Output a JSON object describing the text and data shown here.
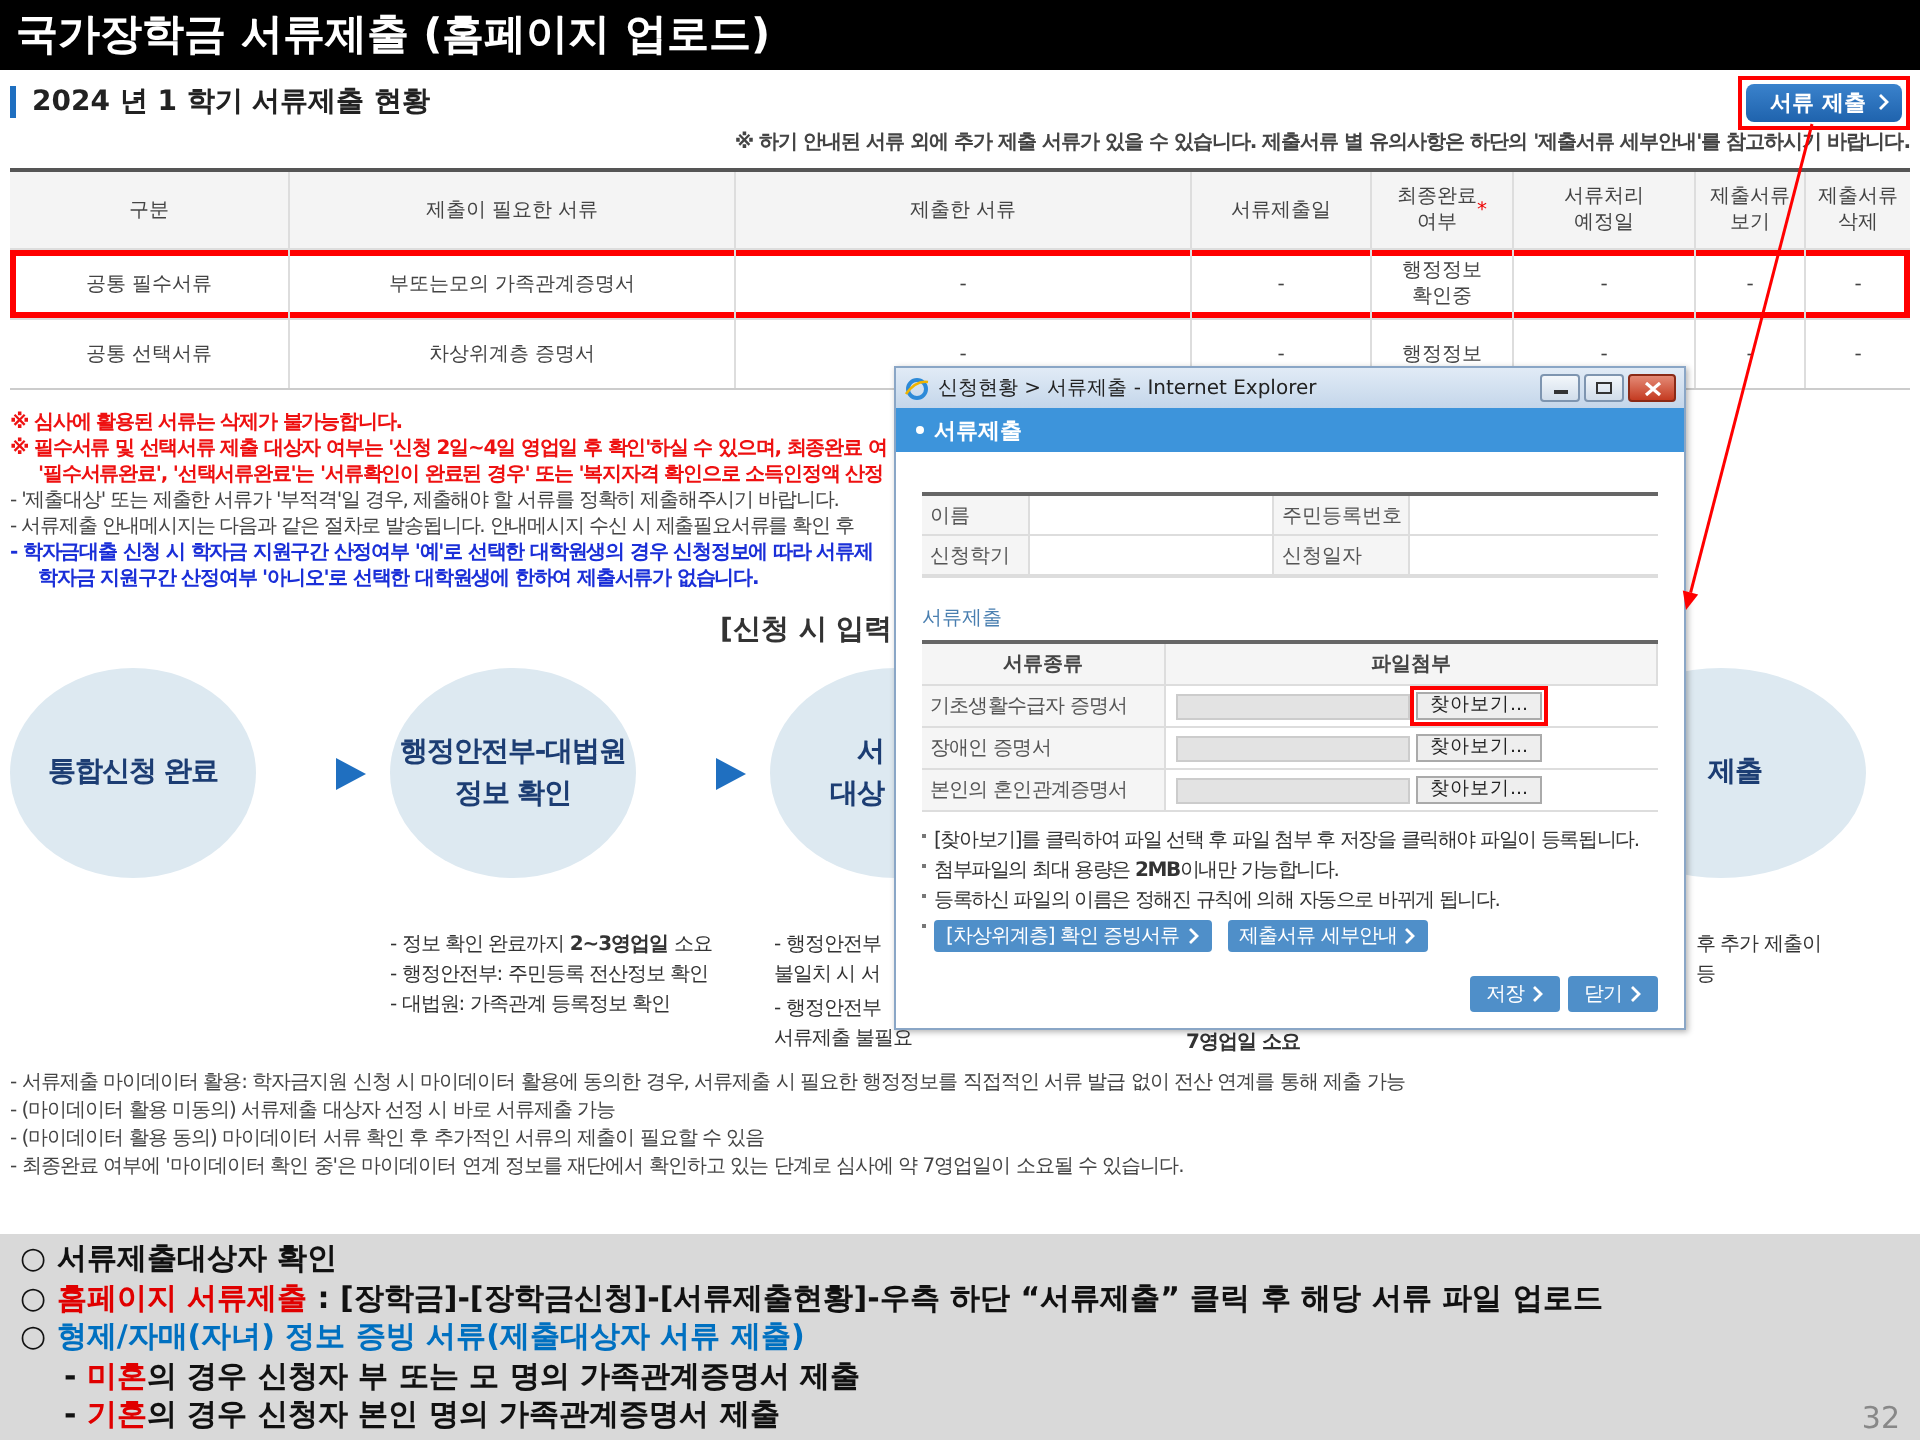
{
  "slide_title": "국가장학금 서류제출 (홈페이지 업로드)",
  "status": {
    "heading": "2024 년 1 학기 서류제출 현황",
    "submit_button": {
      "label": "서류 제출",
      "highlighted": true
    },
    "note": "※ 하기 안내된 서류 외에 추가 제출 서류가 있을 수 있습니다. 제출서류 별 유의사항은 하단의 '제출서류 세부안내'를 참고하시기 바랍니다."
  },
  "table": {
    "columns": [
      {
        "label": "구분"
      },
      {
        "label": "제출이 필요한 서류"
      },
      {
        "label": "제출한 서류"
      },
      {
        "label": "서류제출일"
      },
      {
        "label": "최종완료\n여부",
        "required_mark": "*"
      },
      {
        "label": "서류처리\n예정일"
      },
      {
        "label": "제출서류\n보기"
      },
      {
        "label": "제출서류\n삭제"
      }
    ],
    "rows": [
      {
        "cells": [
          "공통 필수서류",
          "부또는모의 가족관계증명서",
          "-",
          "-",
          "행정정보\n확인중",
          "-",
          "-",
          "-"
        ],
        "highlighted": true
      },
      {
        "cells": [
          "공통 선택서류",
          "차상위계층 증명서",
          "-",
          "-",
          "행정정보",
          "-",
          "-",
          "-"
        ],
        "highlighted": false
      }
    ]
  },
  "notes": [
    {
      "kind": "warning",
      "text": "※ 심사에 활용된 서류는 삭제가 불가능합니다."
    },
    {
      "kind": "warning",
      "text": "※ 필수서류 및 선택서류 제출 대상자 여부는 '신청 2일~4일 영업일 후 확인'하실 수 있으며, 최종완료 여"
    },
    {
      "kind": "warning-continued",
      "text": "'필수서류완료', '선택서류완료'는 '서류확인이 완료된 경우' 또는 '복지자격 확인으로 소득인정액 산정"
    },
    {
      "kind": "plain",
      "text": "- '제출대상' 또는 제출한 서류가 '부적격'일 경우, 제출해야 할 서류를 정확히 제출해주시기 바랍니다."
    },
    {
      "kind": "plain",
      "text": "- 서류제출 안내메시지는 다음과 같은 절차로 발송됩니다. 안내메시지 수신 시 제출필요서류를 확인 후"
    },
    {
      "kind": "info",
      "text": "- 학자금대출 신청 시 학자금 지원구간 산정여부 '예'로 선택한 대학원생의 경우 신청정보에 따라 서류제"
    },
    {
      "kind": "info-continued",
      "text": "학자금 지원구간 산정여부 '아니오'로 선택한 대학원생에 한하여 제출서류가 없습니다."
    }
  ],
  "flow": {
    "caption": "[신청 시 입력",
    "steps": [
      {
        "lines": [
          "통합신청 완료"
        ]
      },
      {
        "lines": [
          "행정안전부-대법원",
          "정보 확인"
        ]
      },
      {
        "lines": [
          "서",
          "대상"
        ]
      },
      {
        "lines": [
          "제출"
        ]
      }
    ]
  },
  "details": [
    {
      "kind": "bullets",
      "items": [
        "- 정보 확인 완료까지 **2~3영업일** 소요",
        "- 행정안전부: 주민등록 전산정보 확인",
        "- 대법원: 가족관계 등록정보 확인"
      ]
    },
    {
      "kind": "bullets",
      "items": [
        "- 행정안전부\n불일치 시 서",
        "- 행정안전부\n서류제출 불필요"
      ]
    },
    {
      "kind": "strong",
      "items": [
        "7영업일 소요"
      ]
    },
    {
      "kind": "plain",
      "items": [
        "후 추가 제출이\n등"
      ]
    }
  ],
  "footnotes": [
    "- 서류제출 마이데이터 활용: 학자금지원 신청 시 마이데이터 활용에 동의한 경우, 서류제출 시 필요한 행정정보를 직접적인 서류 발급 없이 전산 연계를 통해 제출 가능",
    "- (마이데이터 활용 미동의) 서류제출 대상자 선정 시 바로 서류제출 가능",
    "- (마이데이터 활용 동의) 마이데이터 서류 확인 후 추가적인 서류의 제출이 필요할 수 있음",
    "- 최종완료 여부에 '마이데이터 확인 중'은 마이데이터 연계 정보를 재단에서 확인하고 있는 단계로 심사에 약 7영업일이 소요될 수 있습니다."
  ],
  "popup": {
    "title": "신청현황 > 서류제출 - Internet Explorer",
    "header": "서류제출",
    "info": [
      {
        "label": "이름"
      },
      {
        "label": "주민등록번호"
      },
      {
        "label": "신청학기"
      },
      {
        "label": "신청일자"
      }
    ],
    "section_title": "서류제출",
    "file_table": {
      "columns": [
        "서류종류",
        "파일첨부"
      ],
      "rows": [
        {
          "document": "기초생활수급자 증명서",
          "button": "찾아보기...",
          "highlighted": true
        },
        {
          "document": "장애인 증명서",
          "button": "찾아보기...",
          "highlighted": false
        },
        {
          "document": "본인의 혼인관계증명서",
          "button": "찾아보기...",
          "highlighted": false
        }
      ]
    },
    "notes": [
      {
        "kind": "text",
        "text": "[찾아보기]를 클릭하여 파일 선택 후 파일 첨부 후 저장을 클릭해야 파일이 등록됩니다."
      },
      {
        "kind": "text",
        "text": "첨부파일의 최대 용량은 **2MB**이내만 가능합니다."
      },
      {
        "kind": "text",
        "text": "등록하신 파일의 이름은 정해진 규칙에 의해 자동으로 바뀌게 됩니다."
      },
      {
        "kind": "links",
        "links": [
          "[차상위계층] 확인 증빙서류",
          "제출서류 세부안내"
        ]
      }
    ],
    "buttons": [
      "저장",
      "닫기"
    ]
  },
  "summary": {
    "lines": [
      {
        "marker": "○",
        "segments": [
          {
            "kind": "plain",
            "text": "서류제출대상자 확인"
          }
        ]
      },
      {
        "marker": "○",
        "segments": [
          {
            "kind": "alert",
            "text": "홈페이지 서류제출"
          },
          {
            "kind": "plain",
            "text": " : [장학금]-[장학금신청]-[서류제출현황]-우측 하단 “서류제출” 클릭 후 해당 서류 파일 업로드"
          }
        ]
      },
      {
        "marker": "○",
        "segments": [
          {
            "kind": "accent",
            "text": "형제/자매(자녀) 정보 증빙 서류(제출대상자 서류 제출)"
          }
        ],
        "children": [
          {
            "marker": "-",
            "segments": [
              {
                "kind": "alert",
                "text": "미혼"
              },
              {
                "kind": "plain",
                "text": "의 경우 신청자 부 또는 모 명의 가족관계증명서 제출"
              }
            ]
          },
          {
            "marker": "-",
            "segments": [
              {
                "kind": "alert",
                "text": "기혼"
              },
              {
                "kind": "plain",
                "text": "의 경우 신청자 본인 명의 가족관계증명서 제출"
              }
            ]
          }
        ]
      }
    ],
    "page_number": "32"
  }
}
